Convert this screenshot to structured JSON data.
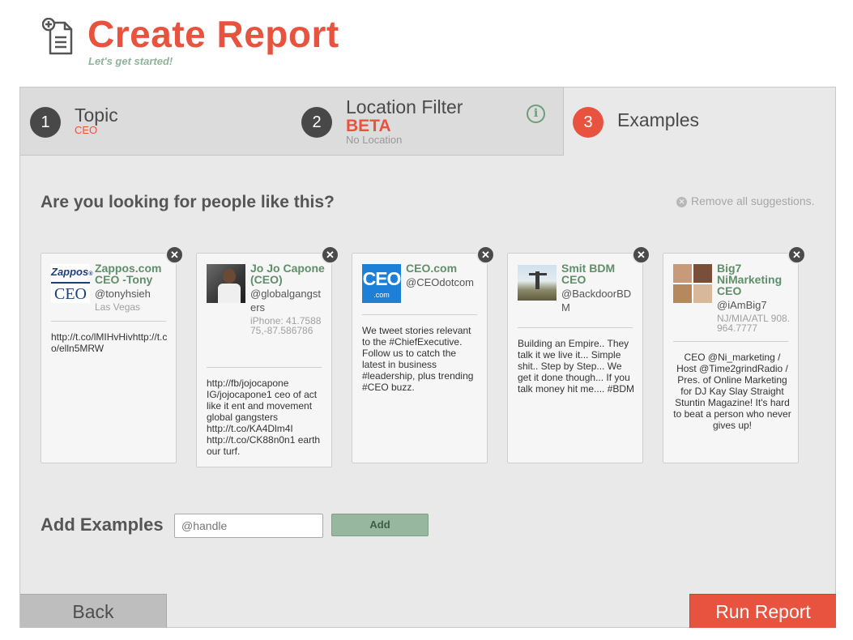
{
  "header": {
    "title": "Create Report",
    "subtitle": "Let's get started!",
    "icon": "new-document-icon"
  },
  "steps": [
    {
      "number": "1",
      "title": "Topic",
      "sub": "CEO"
    },
    {
      "number": "2",
      "title": "Location Filter",
      "badge": "BETA",
      "sub": "No Location",
      "info_icon": "info-icon"
    },
    {
      "number": "3",
      "title": "Examples"
    }
  ],
  "question": "Are you looking for people like this?",
  "remove_all": "Remove all suggestions.",
  "cards": [
    {
      "name": "Zappos.com CEO -Tony",
      "handle": "@tonyhsieh",
      "location": "Las Vegas",
      "bio": "http://t.co/lMIHvHivhttp://t.co/elln5MRW",
      "avatar": "zappos-logo"
    },
    {
      "name": "Jo Jo Capone (CEO)",
      "handle": "@globalgangsters",
      "location": "iPhone: 41.758875,-87.586786",
      "bio": "http://fb/jojocapone IG/jojocapone1 ceo of act like it ent and movement global gangsters http://t.co/KA4Dlm4I http://t.co/CK88n0n1 earth our turf.",
      "avatar": "person-photo"
    },
    {
      "name": "CEO.com",
      "handle": "@CEOdotcom",
      "location": "",
      "bio": "We tweet stories relevant to the #ChiefExecutive. Follow us to catch the latest in business #leadership, plus trending #CEO buzz.",
      "avatar": "ceo-com-logo"
    },
    {
      "name": "Smit BDM CEO",
      "handle": "@BackdoorBDM",
      "location": "",
      "bio": "Building an Empire.. They talk it we live it... Simple shit.. Step by Step... We get it done though... If you talk money hit me.... #BDM",
      "avatar": "landscape-photo"
    },
    {
      "name": "Big7 NiMarketing CEO",
      "handle": "@iAmBig7",
      "location": "NJ/MIA/ATL 908.964.7777",
      "bio": "CEO @Ni_marketing / Host @Time2grindRadio / Pres. of Online Marketing for DJ Kay Slay Straight Stuntin Magazine! It's hard to beat a person who never gives up!",
      "avatar": "collage-photo"
    }
  ],
  "add": {
    "label": "Add Examples",
    "placeholder": "@handle",
    "button": "Add"
  },
  "footer": {
    "back": "Back",
    "run": "Run Report"
  },
  "colors": {
    "accent": "#e8533f",
    "green": "#5f8e6a",
    "panel": "#e9e9e9"
  }
}
